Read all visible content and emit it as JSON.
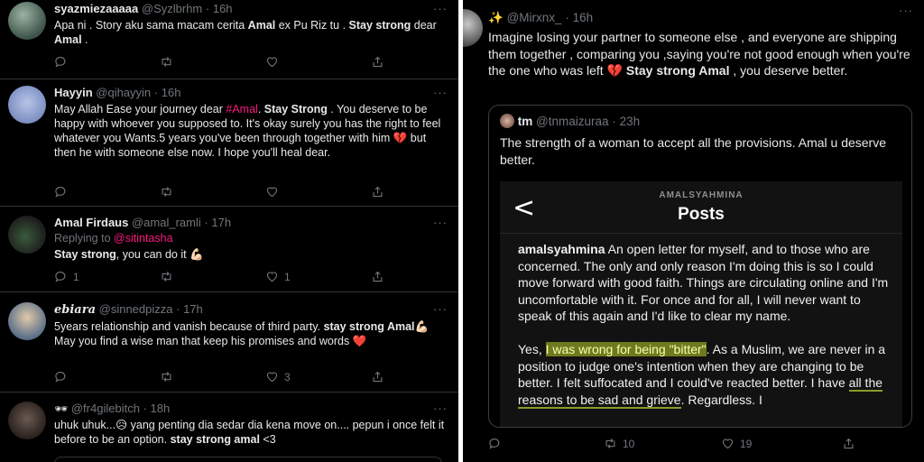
{
  "left_feed": [
    {
      "name": "syazmiezaaaaa",
      "handle": "@Syzlbrhm",
      "time": "16h",
      "text_parts": [
        "Apa ni . Story aku sama macam cerita ",
        "Amal",
        " ex Pu Riz tu . ",
        "Stay strong",
        " dear ",
        "Amal",
        " ."
      ],
      "counts": {
        "reply": "",
        "retweet": "",
        "like": ""
      }
    },
    {
      "name": "Hayyin",
      "handle": "@qihayyin",
      "time": "16h",
      "text_parts": [
        "May Allah Ease your journey dear ",
        "#Amal",
        ". ",
        "Stay Strong",
        " . You deserve to be happy with whoever you supposed to. It's okay surely you has the right to feel whatever you Wants.5 years you've been through together with him ",
        "💔",
        " but then he  with someone else now. I hope you'll heal dear."
      ],
      "counts": {
        "reply": "",
        "retweet": "",
        "like": ""
      }
    },
    {
      "name": "Amal Firdaus",
      "handle": "@amal_ramli",
      "time": "17h",
      "replying_label": "Replying to",
      "replying_to": "@sitintasha",
      "text_parts": [
        "Stay strong",
        ", you can do it ",
        "💪🏻"
      ],
      "counts": {
        "reply": "1",
        "retweet": "",
        "like": "1"
      }
    },
    {
      "name": "ebiara",
      "handle": "@sinnedpizza",
      "time": "17h",
      "text_parts": [
        "5years relationship and vanish because of third party. ",
        "stay strong Amal",
        "💪🏻",
        "May you find a wise man that keep his promises and words ",
        "❤️"
      ],
      "counts": {
        "reply": "",
        "retweet": "",
        "like": "3"
      }
    },
    {
      "name": "",
      "handle": "@fr4gilebitch",
      "time": "18h",
      "text_parts": [
        "uhuk uhuk...",
        "😥",
        " yang penting dia sedar dia kena move on.... pepun i once felt it before to be an option. ",
        "stay strong amal",
        " <3"
      ]
    }
  ],
  "right_tweet": {
    "name": "Mirxnx_",
    "handle": "@Mirxnx_",
    "time": "16h",
    "text_parts": [
      "Imagine losing your partner to someone else , and everyone are shipping them together , comparing you ,saying you're not good enough when you're the one who was left ",
      "💔",
      " ",
      "Stay strong Amal",
      " , you deserve better."
    ],
    "quoted": {
      "name": "tm",
      "handle": "@tnmaizuraa",
      "time": "23h",
      "text": "The strength of a woman to accept all the provisions. Amal u deserve better.",
      "ig": {
        "back": "<",
        "account": "AMALSYAHMINA",
        "title": "Posts",
        "username": "amalsyahmina",
        "p1": " An open letter for myself, and to those who are concerned. The only and only reason I'm doing this is so I could move forward with good faith. Things are circulating online and I'm uncomfortable with it. For once and for all, I will never want to speak of this again and I'd like to clear my name.",
        "p2_a": "Yes, ",
        "p2_highlight": "I was wrong for being \"bitter\"",
        "p2_b": ". As a Muslim, we are never in a position to judge one's intention when they are changing to be better. I felt suffocated and I could've reacted better. I have ",
        "p2_underline": "all the reasons to be sad and grieve",
        "p2_c": ". Regardless. I"
      }
    },
    "counts": {
      "reply": "",
      "retweet": "10",
      "like": "19"
    }
  },
  "colors": {
    "background": "#000000",
    "text": "#e7e9ea",
    "muted": "#71767b",
    "hashtag": "#f91880",
    "highlight": "#6e7a1d"
  },
  "icons": [
    "reply-icon",
    "retweet-icon",
    "like-icon",
    "share-icon",
    "more-icon",
    "sparkles-icon",
    "glasses-icon"
  ]
}
